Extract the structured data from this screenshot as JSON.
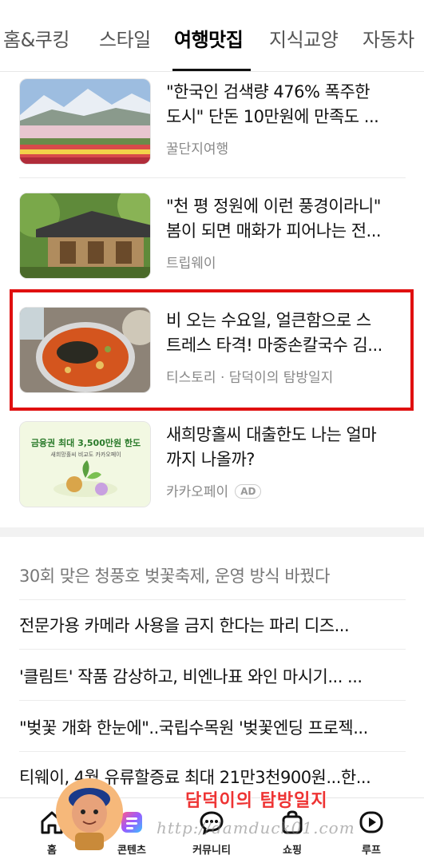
{
  "tabs": [
    {
      "label": "홈&쿠킹",
      "active": false
    },
    {
      "label": "스타일",
      "active": false
    },
    {
      "label": "여행맛집",
      "active": true
    },
    {
      "label": "지식교양",
      "active": false
    },
    {
      "label": "자동차",
      "active": false
    }
  ],
  "cards": [
    {
      "title_line1": "\"한국인 검색량 476% 폭주한",
      "title_line2": "도시\" 단돈 10만원에 만족도 ...",
      "source": "꿀단지여행",
      "thumb": "mountain-flowers"
    },
    {
      "title_line1": "\"천 평 정원에 이런 풍경이라니\"",
      "title_line2": "봄이 되면 매화가 피어나는 전...",
      "source": "트립웨이",
      "thumb": "hanok-garden"
    },
    {
      "title_line1": "비 오는 수요일, 얼큰함으로 스",
      "title_line2": "트레스 타격! 마중손칼국수 김...",
      "source": "티스토리 · 담덕이의 탐방일지",
      "thumb": "spicy-noodle-soup",
      "highlighted": true
    },
    {
      "title_line1": "새희망홀씨 대출한도 나는 얼마",
      "title_line2": "까지 나올까?",
      "source": "카카오페이",
      "ad_label": "AD",
      "thumb": "loan-ad",
      "thumb_text": {
        "headline": "금융권 최대 3,500만원 한도",
        "sub": "새희망홀씨 비교도 카카오페이"
      }
    }
  ],
  "headlines": [
    "30회 맞은 청풍호 벚꽃축제, 운영 방식 바꿨다",
    "전문가용 카메라 사용을 금지 한다는 파리 디즈...",
    "'클림트' 작품 감상하고, 비엔나표 와인 마시기... ...",
    "\"벚꽃 개화 한눈에\"..국립수목원 '벚꽃엔딩 프로젝...",
    "티웨이, 4월 유류할증료 최대 21만3천900원...한..."
  ],
  "bottom_nav": [
    {
      "label": "홈",
      "icon": "home-icon"
    },
    {
      "label": "콘텐츠",
      "icon": "content-icon"
    },
    {
      "label": "커뮤니티",
      "icon": "community-icon"
    },
    {
      "label": "쇼핑",
      "icon": "shopping-icon"
    },
    {
      "label": "루프",
      "icon": "loop-icon"
    }
  ],
  "watermark": {
    "name": "담덕이의 탐방일지",
    "url": "http://damduck01.com"
  },
  "colors": {
    "highlight": "#e01010",
    "accent_tab": "#111111",
    "watermark": "#e33333"
  }
}
